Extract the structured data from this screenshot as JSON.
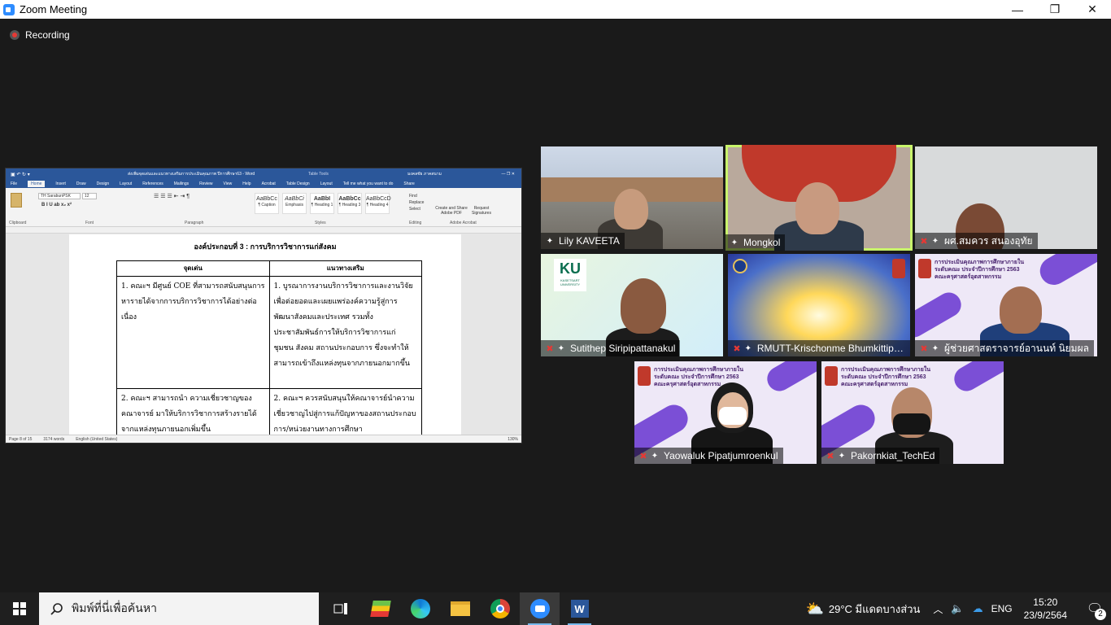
{
  "window": {
    "title": "Zoom Meeting",
    "controls": {
      "minimize": "—",
      "restore": "❐",
      "close": "✕"
    }
  },
  "recording": {
    "label": "Recording"
  },
  "share": {
    "word": {
      "doc_title": "ส่งเพิ่มจุดเด่นและแนวทางเสริมการประเมินคุณภาพ ปีการศึกษา63 - Word",
      "table_tools": "Table Tools",
      "user": "มงคลชัย ภาคสนาม",
      "tabs": [
        "File",
        "Home",
        "Insert",
        "Draw",
        "Design",
        "Layout",
        "References",
        "Mailings",
        "Review",
        "View",
        "Help",
        "Acrobat",
        "Table Design",
        "Layout",
        "Tell me what you want to do",
        "Share"
      ],
      "font_name": "TH SarabunPSK",
      "font_size": "12",
      "styles": [
        "AaBbCc",
        "AaBbCi",
        "AaBbI",
        "AaBbCc",
        "AaBbCcD"
      ],
      "style_names": [
        "¶ Caption",
        "Emphasis",
        "¶ Heading 1",
        "¶ Heading 3",
        "¶ Heading 4"
      ],
      "groups": [
        "Clipboard",
        "Font",
        "Paragraph",
        "Styles",
        "Editing",
        "Adobe Acrobat"
      ],
      "editing": [
        "Find",
        "Replace",
        "Select"
      ],
      "acrobat": [
        "Create and Share Adobe PDF",
        "Request Signatures"
      ],
      "heading": "องค์ประกอบที่ 3 : การบริการวิชาการแก่สังคม",
      "table": {
        "headers": [
          "จุดเด่น",
          "แนวทางเสริม"
        ],
        "rows": [
          [
            "1. คณะฯ มีศูนย์ COE ที่สามารถสนับสนุนการหารายได้จากการบริการวิชาการได้อย่างต่อเนื่อง",
            "1. บูรณาการงานบริการวิชาการและงานวิจัยเพื่อต่อยอดและเผยแพร่องค์ความรู้สู่การพัฒนาสังคมและประเทศ รวมทั้งประชาสัมพันธ์การให้บริการวิชาการแก่ ชุมชน สังคม สถานประกอบการ ซึ่งจะทำให้สามารถเข้าถึงแหล่งทุนจากภายนอกมากขึ้น"
          ],
          [
            "2. คณะฯ สามารถนำ ความเชี่ยวชาญของคณาจารย์ มาให้บริการวิชาการสร้างรายได้จากแหล่งทุนภายนอกเพิ่มขึ้น",
            "2. คณะฯ ควรสนับสนุนให้คณาจารย์นำความเชี่ยวชาญไปสู่การแก้ปัญหาของสถานประกอบการ/หน่วยงานทางการศึกษา"
          ]
        ]
      },
      "status": {
        "page": "Page 8 of 15",
        "words": "3174 words",
        "lang": "English (United States)",
        "zoom": "130%"
      }
    }
  },
  "participants": [
    {
      "name": "Lily KAVEETA",
      "muted": false
    },
    {
      "name": "Mongkol",
      "muted": false
    },
    {
      "name": "ผศ.สมควร  สนองอุทัย",
      "muted": true
    },
    {
      "name": "Sutithep  Siripipattanakul",
      "muted": true
    },
    {
      "name": "RMUTT-Krischonme Bhumkittipich",
      "muted": true
    },
    {
      "name": "ผู้ช่วยศาสตราจารย์อานนท์ นิยมผล",
      "muted": true
    },
    {
      "name": "Yaowaluk Pipatjumroenkul",
      "muted": true
    },
    {
      "name": "Pakornkiat_TechEd",
      "muted": true
    }
  ],
  "tile_texts": {
    "ku_logo": "KU",
    "ku_sub": "KASETSART UNIVERSITY",
    "slide_line1": "การประเมินคุณภาพการศึกษาภายใน",
    "slide_line2": "ระดับคณะ ประจำปีการศึกษา 2563",
    "slide_line3": "คณะครุศาสตร์อุตสาหกรรม"
  },
  "taskbar": {
    "search_placeholder": "พิมพ์ที่นี่เพื่อค้นหา",
    "weather": "29°C  มีแดดบางส่วน",
    "lang": "ENG",
    "time": "15:20",
    "date": "23/9/2564",
    "notifications": "2"
  },
  "colors": {
    "active_speaker": "#c9f56b",
    "zoom_blue": "#2d8cff",
    "word_blue": "#2b579a"
  }
}
